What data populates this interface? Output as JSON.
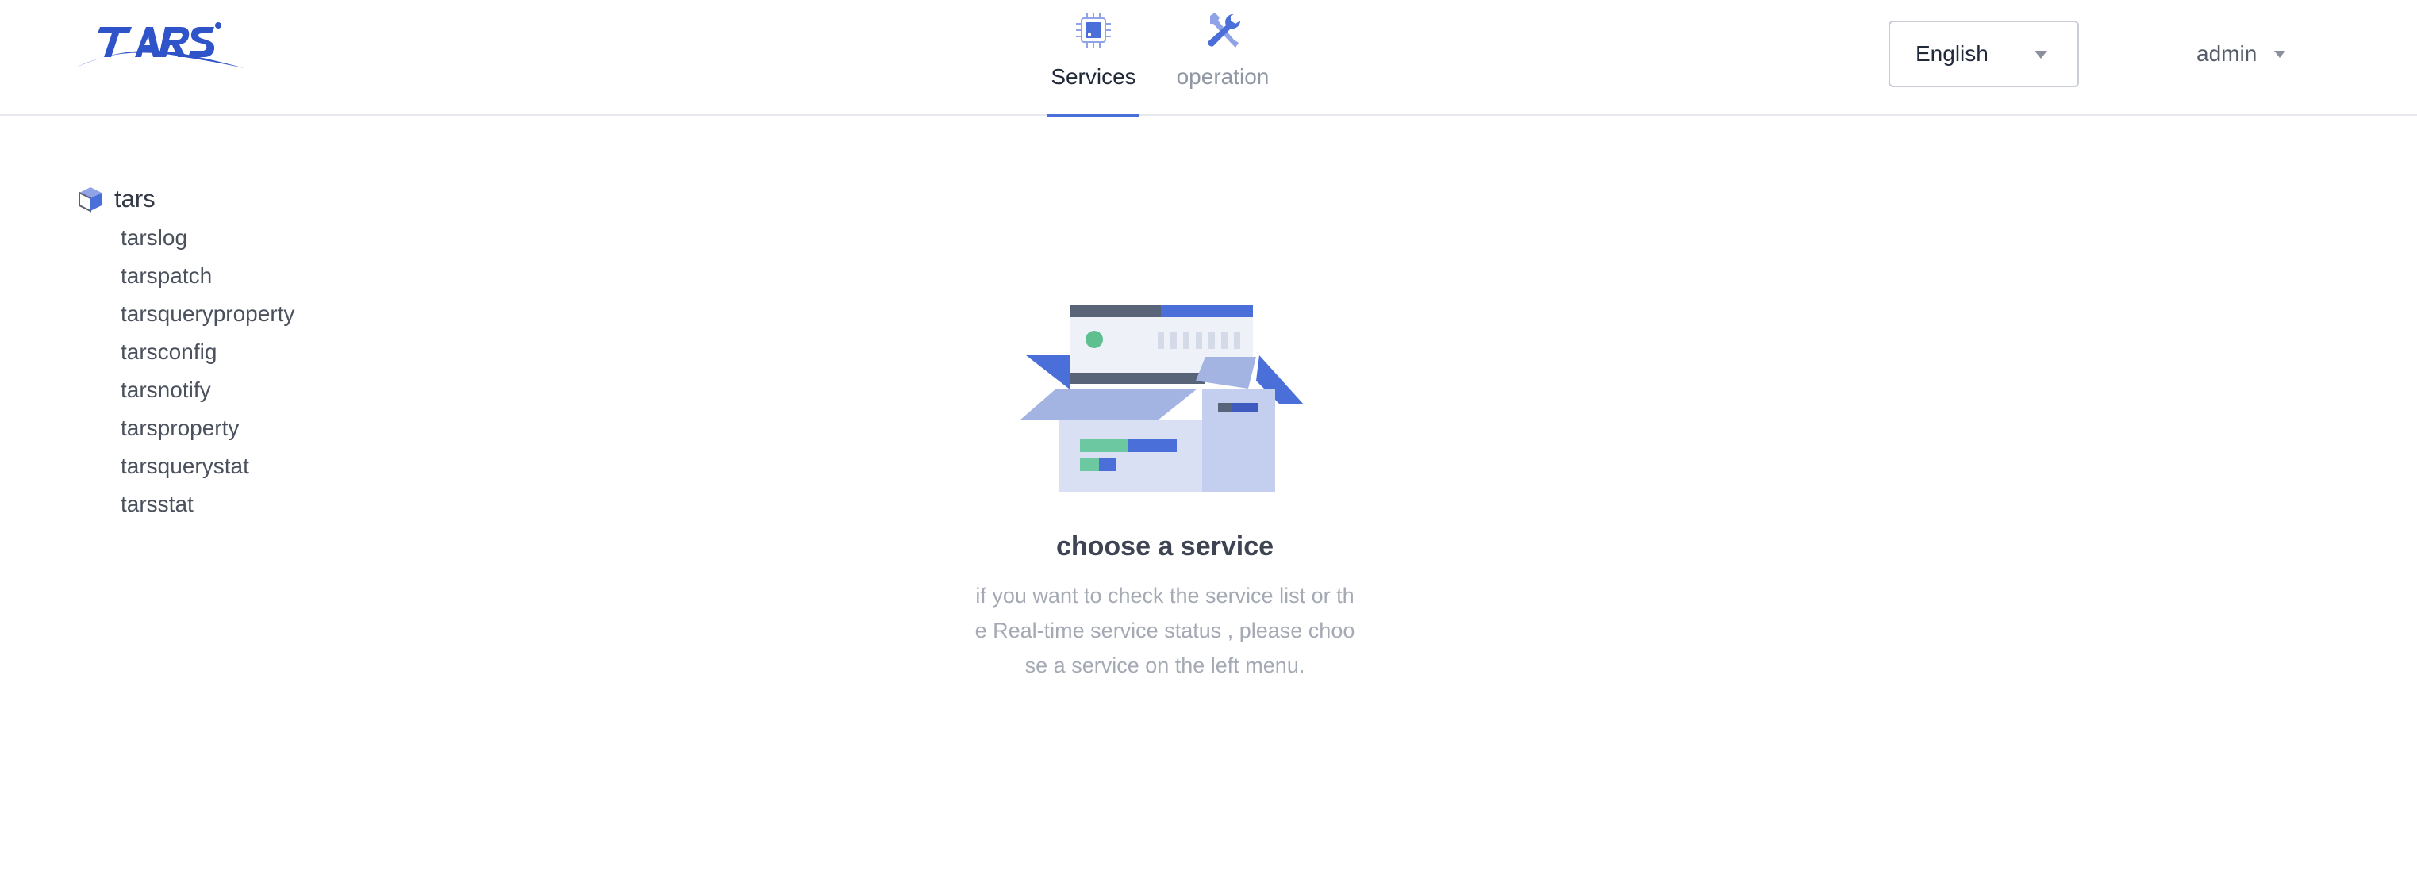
{
  "header": {
    "logo_text": "TARS",
    "nav": [
      {
        "label": "Services",
        "icon": "chip-icon",
        "active": true
      },
      {
        "label": "operation",
        "icon": "wrench-icon",
        "active": false
      }
    ],
    "language": {
      "selected": "English"
    },
    "user": {
      "name": "admin"
    }
  },
  "sidebar": {
    "root": {
      "label": "tars",
      "icon": "cube-icon"
    },
    "items": [
      {
        "label": "tarslog"
      },
      {
        "label": "tarspatch"
      },
      {
        "label": "tarsqueryproperty"
      },
      {
        "label": "tarsconfig"
      },
      {
        "label": "tarsnotify"
      },
      {
        "label": "tarsproperty"
      },
      {
        "label": "tarsquerystat"
      },
      {
        "label": "tarsstat"
      }
    ]
  },
  "empty_state": {
    "illustration": "open-box-icon",
    "title": "choose a service",
    "description": "if you want to check the service list or the Real-time service status , please choose a service on the left menu."
  },
  "colors": {
    "accent": "#4a6fd8",
    "logo": "#2f53c9",
    "text_muted": "#a4a9b4"
  }
}
